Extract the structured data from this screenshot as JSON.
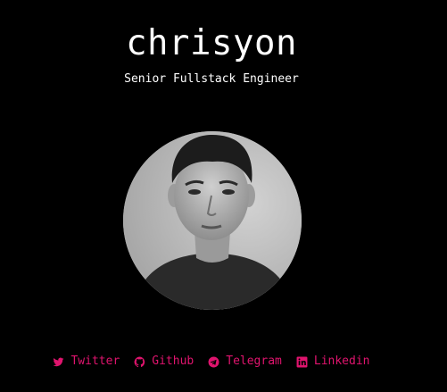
{
  "profile": {
    "name": "chrisyon",
    "role": "Senior Fullstack Engineer"
  },
  "socials": [
    {
      "label": "Twitter",
      "icon": "twitter-icon"
    },
    {
      "label": "Github",
      "icon": "github-icon"
    },
    {
      "label": "Telegram",
      "icon": "telegram-icon"
    },
    {
      "label": "Linkedin",
      "icon": "linkedin-icon"
    }
  ],
  "colors": {
    "background": "#000000",
    "text": "#ffffff",
    "accent": "#e0146e"
  }
}
